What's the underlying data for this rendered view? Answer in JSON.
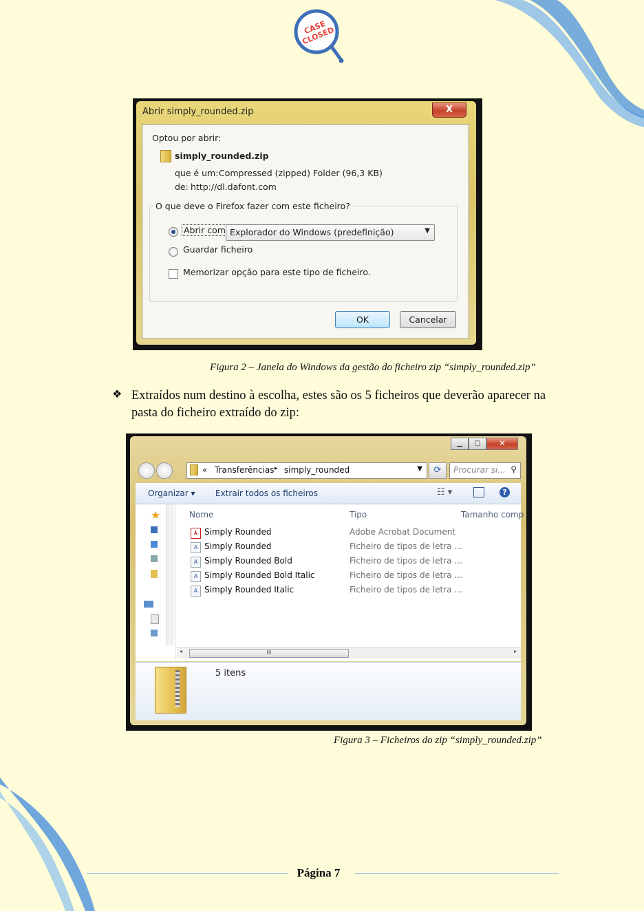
{
  "logo": {
    "line1": "CASE",
    "line2": "CLOSED"
  },
  "figure2": {
    "dialog_title": "Abrir simply_rounded.zip",
    "close_label": "X",
    "intro": "Optou por abrir:",
    "file_name": "simply_rounded.zip",
    "type_label": "que é um:",
    "type_value": "Compressed (zipped) Folder (96,3 KB)",
    "from_label": "de:",
    "from_value": "http://dl.dafont.com",
    "question": "O que deve o Firefox fazer com este ficheiro?",
    "open_with_label": "Abrir com",
    "open_with_app": "Explorador do Windows (predefinição)",
    "save_label": "Guardar ficheiro",
    "remember_label": "Memorizar opção para este tipo de ficheiro.",
    "ok_label": "OK",
    "cancel_label": "Cancelar",
    "caption": "Figura 2 – Janela do Windows da gestão do ficheiro zip “simply_rounded.zip”"
  },
  "paragraph": {
    "bullet": "❖",
    "text": "Extraídos num destino à escolha, estes são os 5 ficheiros que deverão aparecer na pasta do ficheiro extraído do zip:"
  },
  "figure3": {
    "breadcrumb_prefix": "«",
    "breadcrumb_1": "Transferências",
    "breadcrumb_sep": "▸",
    "breadcrumb_2": "simply_rounded",
    "search_placeholder": "Procurar si...",
    "organize_label": "Organizar",
    "extract_label": "Extrair todos os ficheiros",
    "col_name": "Nome",
    "col_type": "Tipo",
    "col_size": "Tamanho comp",
    "files": [
      {
        "name": "Simply Rounded",
        "type": "Adobe Acrobat Document",
        "icon": "pdf-icon"
      },
      {
        "name": "Simply Rounded",
        "type": "Ficheiro de tipos de letra ...",
        "icon": "font-file-icon"
      },
      {
        "name": "Simply Rounded Bold",
        "type": "Ficheiro de tipos de letra ...",
        "icon": "font-file-icon"
      },
      {
        "name": "Simply Rounded Bold Italic",
        "type": "Ficheiro de tipos de letra ...",
        "icon": "font-file-icon"
      },
      {
        "name": "Simply Rounded Italic",
        "type": "Ficheiro de tipos de letra ...",
        "icon": "font-file-icon"
      }
    ],
    "item_count": "5 itens",
    "caption": "Figura 3 – Ficheiros do zip “simply_rounded.zip”"
  },
  "footer": {
    "page_label": "Página 7"
  }
}
